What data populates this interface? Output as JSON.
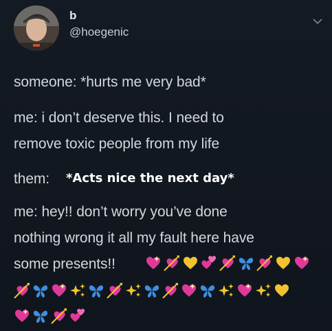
{
  "user": {
    "display_name": "b",
    "handle": "@hoegenic"
  },
  "tweet": {
    "lines": [
      "someone: *hurts me very bad*",
      "me: i don’t deserve this. I need to",
      "remove toxic people from my life",
      "them:",
      "me: hey!! don’t worry you’ve done",
      "nothing wrong it all my fault here have",
      "some presents!!"
    ],
    "overlay_text": "*Acts nice the next day*"
  },
  "emojis": {
    "row1": [
      "heart-sparkle",
      "heart-arrow",
      "yellow-heart",
      "two-hearts",
      "heart-arrow",
      "butterfly",
      "heart-arrow",
      "yellow-heart",
      "heart-sparkle"
    ],
    "row2": [
      "heart-arrow",
      "butterfly",
      "heart-sparkle",
      "sparkles",
      "butterfly",
      "heart-arrow",
      "sparkles",
      "butterfly",
      "heart-arrow",
      "heart-sparkle",
      "butterfly",
      "sparkles",
      "heart-sparkle",
      "sparkles",
      "yellow-heart"
    ],
    "row3": [
      "heart-sparkle",
      "butterfly",
      "heart-arrow",
      "two-hearts"
    ]
  },
  "colors": {
    "background": "#121821",
    "text": "#d3d7dc",
    "pink": "#e0399a",
    "yellow": "#f2c32f",
    "blue": "#3f8fe0"
  }
}
